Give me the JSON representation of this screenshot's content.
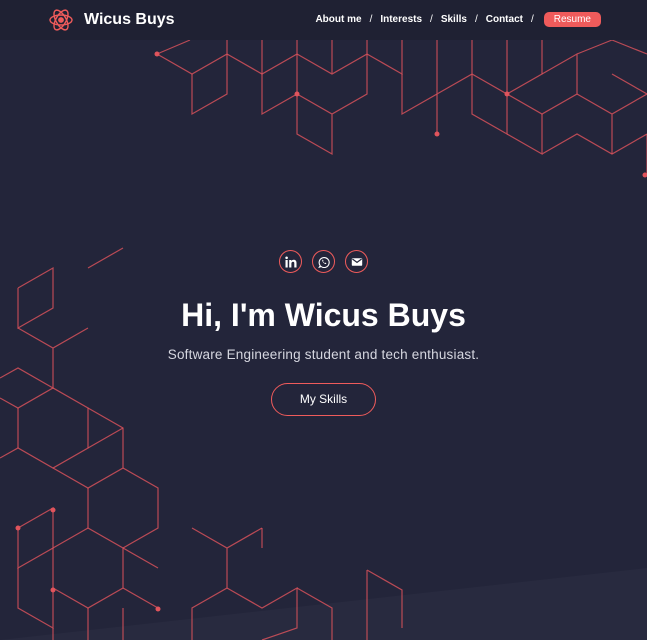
{
  "nav": {
    "brand": "Wicus Buys",
    "links": [
      {
        "label": "About me"
      },
      {
        "label": "Interests"
      },
      {
        "label": "Skills"
      },
      {
        "label": "Contact"
      }
    ],
    "separator": "/",
    "resume_label": "Resume"
  },
  "hero": {
    "social": [
      {
        "icon": "linkedin-icon"
      },
      {
        "icon": "whatsapp-icon"
      },
      {
        "icon": "mail-icon"
      }
    ],
    "title": "Hi, I'm Wicus Buys",
    "subtitle": "Software Engineering student and tech enthusiast.",
    "cta_label": "My Skills"
  },
  "colors": {
    "background": "#23253a",
    "navbar": "#1f2133",
    "accent": "#ef5b5b",
    "text": "#ffffff"
  }
}
